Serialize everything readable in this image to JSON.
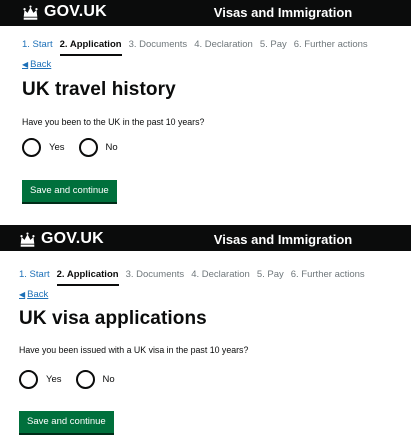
{
  "colors": {
    "header_bg": "#0b0c0c",
    "link": "#1d70b8",
    "button_green": "#00703c",
    "text": "#0b0c0c"
  },
  "screens": [
    {
      "logo_text": "GOV.UK",
      "crown_icon": "crown-icon",
      "service_name": "Visas and Immigration",
      "steps": [
        "1. Start",
        "2. Application",
        "3. Documents",
        "4. Declaration",
        "5. Pay",
        "6. Further actions"
      ],
      "current_step": 1,
      "back_link": "Back",
      "title": "UK travel history",
      "question": "Have you been to the UK in the past 10 years?",
      "options": [
        "Yes",
        "No"
      ],
      "button": "Save and continue"
    },
    {
      "logo_text": "GOV.UK",
      "crown_icon": "crown-icon",
      "service_name": "Visas and Immigration",
      "steps": [
        "1. Start",
        "2. Application",
        "3. Documents",
        "4. Declaration",
        "5. Pay",
        "6. Further actions"
      ],
      "current_step": 1,
      "back_link": "Back",
      "title": "UK visa applications",
      "question": "Have you been issued with a UK visa in the past 10 years?",
      "options": [
        "Yes",
        "No"
      ],
      "button": "Save and continue"
    }
  ]
}
